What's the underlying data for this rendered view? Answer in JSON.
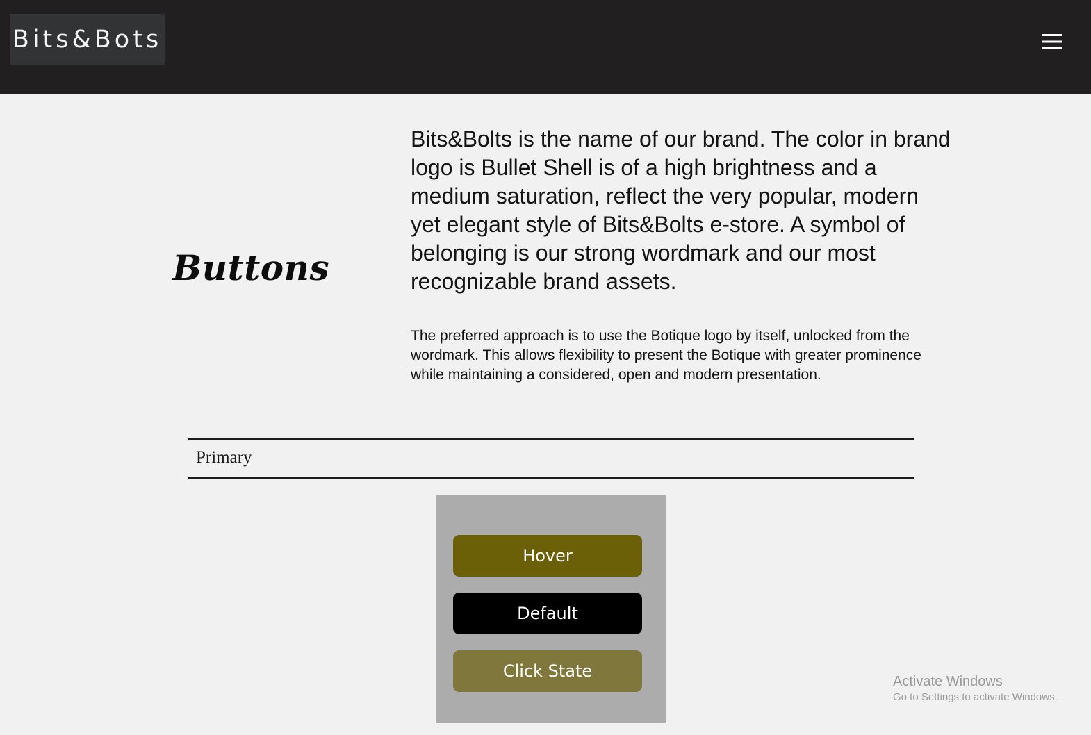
{
  "header": {
    "logo": "Bits&Bots",
    "menu_icon": "hamburger-menu-icon"
  },
  "section": {
    "title": "Buttons",
    "lead": "Bits&Bolts is the name of our brand. The color in brand logo is Bullet Shell is of a high brightness and a medium saturation, reflect the very popular, modern yet elegant style of Bits&Bolts e-store. A symbol of belonging is our strong wordmark and our most recognizable brand assets.",
    "body": "The preferred approach is to use the Botique logo by itself, unlocked from the wordmark. This allows flexibility to present the Botique with greater prominence while maintaining a considered, open and modern presentation."
  },
  "primary": {
    "label": "Primary",
    "buttons": [
      {
        "label": "Hover",
        "color": "#6b5f07"
      },
      {
        "label": "Default",
        "color": "#000000"
      },
      {
        "label": "Click State",
        "color": "#7f773b"
      }
    ]
  },
  "watermark": {
    "title": "Activate Windows",
    "subtitle": "Go to Settings to activate Windows."
  },
  "colors": {
    "header_bg": "#221f20",
    "page_bg": "#f1f1f1",
    "panel_bg": "#acacac"
  }
}
